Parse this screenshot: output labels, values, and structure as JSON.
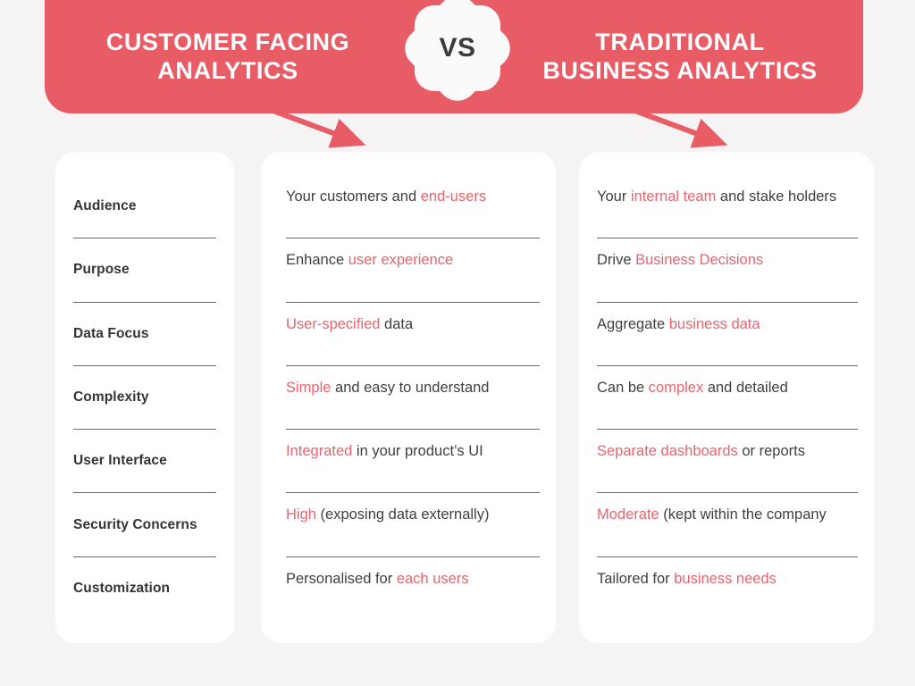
{
  "theme": {
    "accent_red": "#e85c66",
    "accent_text_red": "#e8636d",
    "background": "#f5f3f3",
    "card_background": "#ffffff",
    "label_text": "#343437",
    "body_text": "#3f3f42",
    "divider": "#666666"
  },
  "header": {
    "left_title": "CUSTOMER FACING ANALYTICS",
    "left_title_line1": "CUSTOMER FACING",
    "left_title_line2": "ANALYTICS",
    "right_title": "TRADITIONAL BUSINESS ANALYTICS",
    "right_title_line1": "TRADITIONAL",
    "right_title_line2": "BUSINESS ANALYTICS",
    "vs_label": "VS"
  },
  "comparison": {
    "rows": [
      {
        "label": "Audience",
        "customer_facing": [
          {
            "text": "Your customers and ",
            "accent": false
          },
          {
            "text": "end-users",
            "accent": true
          }
        ],
        "customer_facing_plain": "Your customers and end-users",
        "traditional": [
          {
            "text": "Your ",
            "accent": false
          },
          {
            "text": "internal team",
            "accent": true
          },
          {
            "text": " and stake holders",
            "accent": false
          }
        ],
        "traditional_plain": "Your internal team and stake holders"
      },
      {
        "label": "Purpose",
        "customer_facing": [
          {
            "text": "Enhance ",
            "accent": false
          },
          {
            "text": "user experience",
            "accent": true
          }
        ],
        "customer_facing_plain": "Enhance user experience",
        "traditional": [
          {
            "text": "Drive ",
            "accent": false
          },
          {
            "text": "Business Decisions",
            "accent": true
          }
        ],
        "traditional_plain": "Drive Business Decisions"
      },
      {
        "label": "Data Focus",
        "customer_facing": [
          {
            "text": "User-specified",
            "accent": true
          },
          {
            "text": " data",
            "accent": false
          }
        ],
        "customer_facing_plain": "User-specified data",
        "traditional": [
          {
            "text": "Aggregate ",
            "accent": false
          },
          {
            "text": "business data",
            "accent": true
          }
        ],
        "traditional_plain": "Aggregate business data"
      },
      {
        "label": "Complexity",
        "customer_facing": [
          {
            "text": "Simple",
            "accent": true
          },
          {
            "text": " and easy to understand",
            "accent": false
          }
        ],
        "customer_facing_plain": "Simple and easy to understand",
        "traditional": [
          {
            "text": "Can be ",
            "accent": false
          },
          {
            "text": "complex",
            "accent": true
          },
          {
            "text": " and detailed",
            "accent": false
          }
        ],
        "traditional_plain": "Can be complex and detailed"
      },
      {
        "label": "User Interface",
        "customer_facing": [
          {
            "text": "Integrated",
            "accent": true
          },
          {
            "text": " in your product’s UI",
            "accent": false
          }
        ],
        "customer_facing_plain": "Integrated in your product’s UI",
        "traditional": [
          {
            "text": "Separate dashboards",
            "accent": true
          },
          {
            "text": " or reports",
            "accent": false
          }
        ],
        "traditional_plain": "Separate dashboards or reports"
      },
      {
        "label": "Security Concerns",
        "customer_facing": [
          {
            "text": "High",
            "accent": true
          },
          {
            "text": " (exposing data externally)",
            "accent": false
          }
        ],
        "customer_facing_plain": "High (exposing data externally)",
        "traditional": [
          {
            "text": "Moderate",
            "accent": true
          },
          {
            "text": " (kept within the company",
            "accent": false
          }
        ],
        "traditional_plain": "Moderate (kept within the company"
      },
      {
        "label": "Customization",
        "customer_facing": [
          {
            "text": "Personalised for ",
            "accent": false
          },
          {
            "text": "each users",
            "accent": true
          }
        ],
        "customer_facing_plain": "Personalised for each users",
        "traditional": [
          {
            "text": "Tailored for ",
            "accent": false
          },
          {
            "text": "business needs",
            "accent": true
          }
        ],
        "traditional_plain": "Tailored for business needs"
      }
    ]
  },
  "arrows": {
    "left_arrow_name": "arrow-to-customer-facing-column",
    "right_arrow_name": "arrow-to-traditional-column"
  }
}
